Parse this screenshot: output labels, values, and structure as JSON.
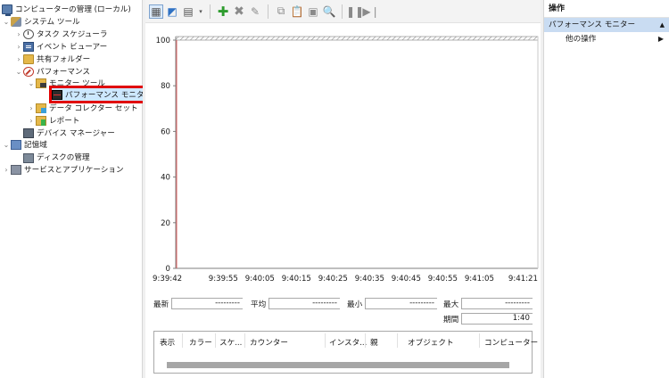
{
  "tree": {
    "root": "コンピューターの管理 (ローカル)",
    "system_tools": "システム ツール",
    "task_scheduler": "タスク スケジューラ",
    "event_viewer": "イベント ビューアー",
    "shared_folders": "共有フォルダー",
    "performance": "パフォーマンス",
    "monitor_tools": "モニター ツール",
    "performance_monitor": "パフォーマンス モニター",
    "data_collector_sets": "データ コレクター セット",
    "reports": "レポート",
    "device_manager": "デバイス マネージャー",
    "storage": "記憶域",
    "disk_management": "ディスクの管理",
    "services_apps": "サービスとアプリケーション"
  },
  "toolbar": {
    "icons": [
      "view-graph-icon",
      "freeze-display-icon",
      "change-graph-type-icon",
      "add-counter-icon",
      "delete-counter-icon",
      "highlight-icon",
      "copy-properties-icon",
      "paste-counter-list-icon",
      "properties-icon",
      "zoom-icon",
      "pause-icon",
      "next-frame-icon"
    ]
  },
  "chart_data": {
    "type": "line",
    "ylim": [
      0,
      100
    ],
    "yticks": [
      "100",
      "80",
      "60",
      "40",
      "20",
      "0"
    ],
    "xticks": [
      "9:39:42",
      "9:39:55",
      "9:40:05",
      "9:40:15",
      "9:40:25",
      "9:40:35",
      "9:40:45",
      "9:40:55",
      "9:41:05",
      "9:41:21"
    ],
    "series": [],
    "grid": false,
    "cursor_color": "#e06060"
  },
  "stats": {
    "latest_label": "最新",
    "latest_value": "---------",
    "average_label": "平均",
    "average_value": "---------",
    "min_label": "最小",
    "min_value": "---------",
    "max_label": "最大",
    "max_value": "---------",
    "duration_label": "期間",
    "duration_value": "1:40"
  },
  "counter_list": {
    "columns": [
      "表示",
      "カラー",
      "スケ...",
      "カウンター",
      "インスタ...",
      "親",
      "オブジェクト",
      "コンピューター"
    ]
  },
  "actions": {
    "header": "操作",
    "section": "パフォーマンス モニター",
    "more": "他の操作"
  }
}
